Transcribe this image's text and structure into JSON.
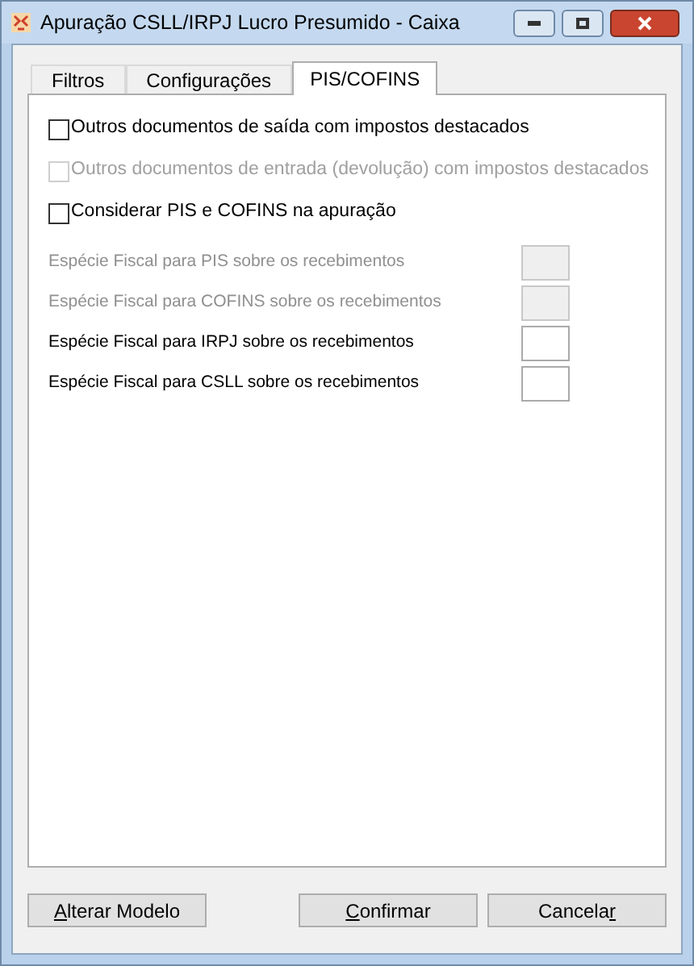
{
  "window": {
    "title": "Apuração CSLL/IRPJ Lucro Presumido - Caixa"
  },
  "tabs": [
    {
      "label": "Filtros",
      "selected": false
    },
    {
      "label": "Configurações",
      "selected": false
    },
    {
      "label": "PIS/COFINS",
      "selected": true
    }
  ],
  "checkboxes": [
    {
      "label": "Outros documentos de saída com impostos destacados",
      "checked": false,
      "disabled": false
    },
    {
      "label": "Outros documentos de entrada (devolução) com impostos destacados",
      "checked": false,
      "disabled": true
    },
    {
      "label": "Considerar PIS e COFINS na apuração",
      "checked": false,
      "disabled": false
    }
  ],
  "fields": [
    {
      "label": "Espécie Fiscal para PIS sobre os recebimentos",
      "disabled": true
    },
    {
      "label": "Espécie Fiscal para COFINS sobre os recebimentos",
      "disabled": true
    },
    {
      "label": "Espécie Fiscal para IRPJ sobre os recebimentos",
      "disabled": false
    },
    {
      "label": "Espécie Fiscal para CSLL sobre os recebimentos",
      "disabled": false
    }
  ],
  "buttons": [
    {
      "kind": "left",
      "accelerator": "A",
      "after": "lterar Modelo"
    },
    {
      "kind": "right",
      "accelerator": "C",
      "after": "onfirmar"
    },
    {
      "kind": "right",
      "before": "Cancela",
      "accelerator": "r"
    }
  ]
}
